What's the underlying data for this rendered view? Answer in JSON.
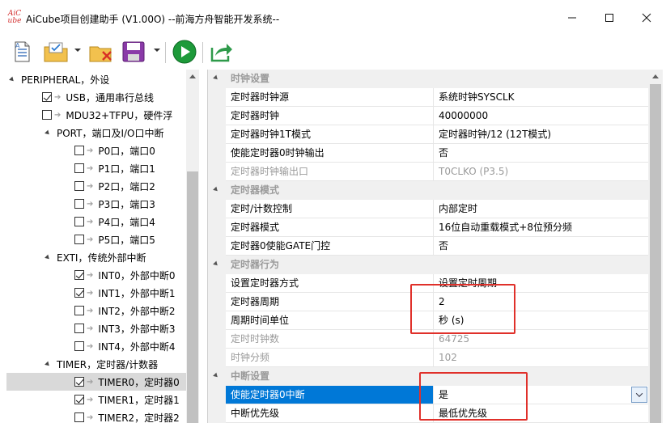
{
  "window": {
    "title": "AiCube项目创建助手 (V1.00O) --前海方舟智能开发系统--",
    "logo_text": "AiC ube"
  },
  "toolbar": {
    "buttons": [
      "new-file-icon",
      "open-folder-icon",
      "delete-icon",
      "save-icon",
      "run-icon",
      "export-icon"
    ]
  },
  "tree": {
    "items": [
      {
        "label": "PERIPHERAL，外设",
        "kind": "group"
      },
      {
        "label": "USB，通用串行总线",
        "kind": "item",
        "checked": true
      },
      {
        "label": "MDU32+TFPU，硬件浮",
        "kind": "item",
        "checked": false
      },
      {
        "label": "PORT，端口及I/O口中断",
        "kind": "group"
      },
      {
        "label": "P0口，端口0",
        "kind": "item",
        "checked": false
      },
      {
        "label": "P1口，端口1",
        "kind": "item",
        "checked": false
      },
      {
        "label": "P2口，端口2",
        "kind": "item",
        "checked": false
      },
      {
        "label": "P3口，端口3",
        "kind": "item",
        "checked": false
      },
      {
        "label": "P4口，端口4",
        "kind": "item",
        "checked": false
      },
      {
        "label": "P5口，端口5",
        "kind": "item",
        "checked": false
      },
      {
        "label": "EXTI，传统外部中断",
        "kind": "group"
      },
      {
        "label": "INT0，外部中断0",
        "kind": "item",
        "checked": true
      },
      {
        "label": "INT1，外部中断1",
        "kind": "item",
        "checked": true
      },
      {
        "label": "INT2，外部中断2",
        "kind": "item",
        "checked": false
      },
      {
        "label": "INT3，外部中断3",
        "kind": "item",
        "checked": false
      },
      {
        "label": "INT4，外部中断4",
        "kind": "item",
        "checked": false
      },
      {
        "label": "TIMER，定时器/计数器",
        "kind": "group"
      },
      {
        "label": "TIMER0，定时器0",
        "kind": "item",
        "checked": true,
        "selected": true
      },
      {
        "label": "TIMER1，定时器1",
        "kind": "item",
        "checked": true
      },
      {
        "label": "TIMER2，定时器2",
        "kind": "item",
        "checked": false
      }
    ]
  },
  "props": {
    "rows": [
      {
        "type": "category",
        "title": "时钟设置"
      },
      {
        "type": "prop",
        "name": "定时器时钟源",
        "value": "系统时钟SYSCLK"
      },
      {
        "type": "prop",
        "name": "定时器时钟",
        "value": "40000000"
      },
      {
        "type": "prop",
        "name": "定时器时钟1T模式",
        "value": "定时器时钟/12 (12T模式)"
      },
      {
        "type": "prop",
        "name": "使能定时器0时钟输出",
        "value": "否"
      },
      {
        "type": "prop",
        "name": "定时器时钟输出口",
        "value": "T0CLKO (P3.5)",
        "disabled": true
      },
      {
        "type": "category",
        "title": "定时器模式"
      },
      {
        "type": "prop",
        "name": "定时/计数控制",
        "value": "内部定时"
      },
      {
        "type": "prop",
        "name": "定时器模式",
        "value": "16位自动重载模式+8位预分频"
      },
      {
        "type": "prop",
        "name": "定时器0使能GATE门控",
        "value": "否"
      },
      {
        "type": "category",
        "title": "定时器行为"
      },
      {
        "type": "prop",
        "name": "设置定时器方式",
        "value": "设置定时周期"
      },
      {
        "type": "prop",
        "name": "定时器周期",
        "value": "2"
      },
      {
        "type": "prop",
        "name": "周期时间单位",
        "value": "秒 (s)"
      },
      {
        "type": "prop",
        "name": "定时时钟数",
        "value": "64725",
        "disabled": true
      },
      {
        "type": "prop",
        "name": "时钟分频",
        "value": "102",
        "disabled": true
      },
      {
        "type": "category",
        "title": "中断设置"
      },
      {
        "type": "prop",
        "name": "使能定时器0中断",
        "value": "是",
        "selected": true,
        "dropdown": true
      },
      {
        "type": "prop",
        "name": "中断优先级",
        "value": "最低优先级"
      }
    ]
  },
  "colors": {
    "selection": "#0078d7",
    "annotation": "#e0302a",
    "category_bg": "#f0f0f0"
  }
}
